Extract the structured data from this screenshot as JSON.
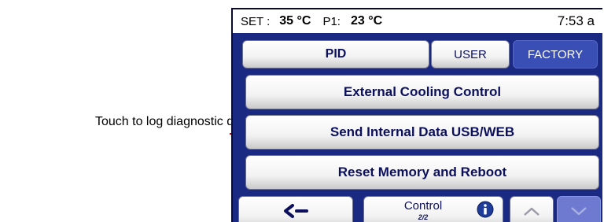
{
  "callout": {
    "text": "Touch to log diagnostic data"
  },
  "status": {
    "set_label": "SET :",
    "set_value": "35 °C",
    "p1_label": "P1:",
    "p1_value": "23 °C",
    "time": "7:53 a"
  },
  "tabs": [
    {
      "label": "PID",
      "selected": false
    },
    {
      "label": "USER",
      "selected": false
    },
    {
      "label": "FACTORY",
      "selected": true
    }
  ],
  "menu": {
    "cooling": "External Cooling Control",
    "send_data": "Send Internal Data USB/WEB",
    "reset": "Reset Memory and Reboot"
  },
  "bottom": {
    "back_icon": "arrow-left-icon",
    "control_label": "Control",
    "page_indicator": "2/2",
    "info_icon": "info-icon",
    "up_icon": "chevron-up-icon",
    "down_icon": "chevron-down-icon"
  },
  "colors": {
    "screen_bg": "#1a2a82",
    "selected_tab": "#3a4fb5",
    "button_text": "#0b0f5c",
    "callout": "#e00000",
    "info_icon": "#1f3c9a"
  }
}
